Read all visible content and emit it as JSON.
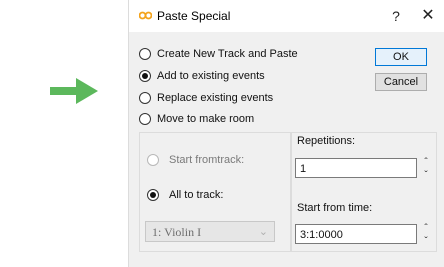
{
  "colors": {
    "arrow": "#5cb85c",
    "title_icon": "#f4a31b",
    "default_button_border": "#0078d7"
  },
  "dialog": {
    "title": "Paste Special",
    "help_label": "?",
    "close_label": "✕",
    "options": [
      {
        "label": "Create New Track and Paste",
        "checked": false
      },
      {
        "label": "Add to existing events",
        "checked": true
      },
      {
        "label": "Replace existing events",
        "checked": false
      },
      {
        "label": "Move to make room",
        "checked": false
      }
    ],
    "ok_label": "OK",
    "cancel_label": "Cancel",
    "track_group": {
      "start_from_track_label": "Start fromtrack:",
      "all_to_track_label": "All to track:",
      "track_select_value": "1: Violin I"
    },
    "repetitions": {
      "label": "Repetitions:",
      "value": "1"
    },
    "start_time": {
      "label": "Start from time:",
      "value": "3:1:0000"
    }
  }
}
